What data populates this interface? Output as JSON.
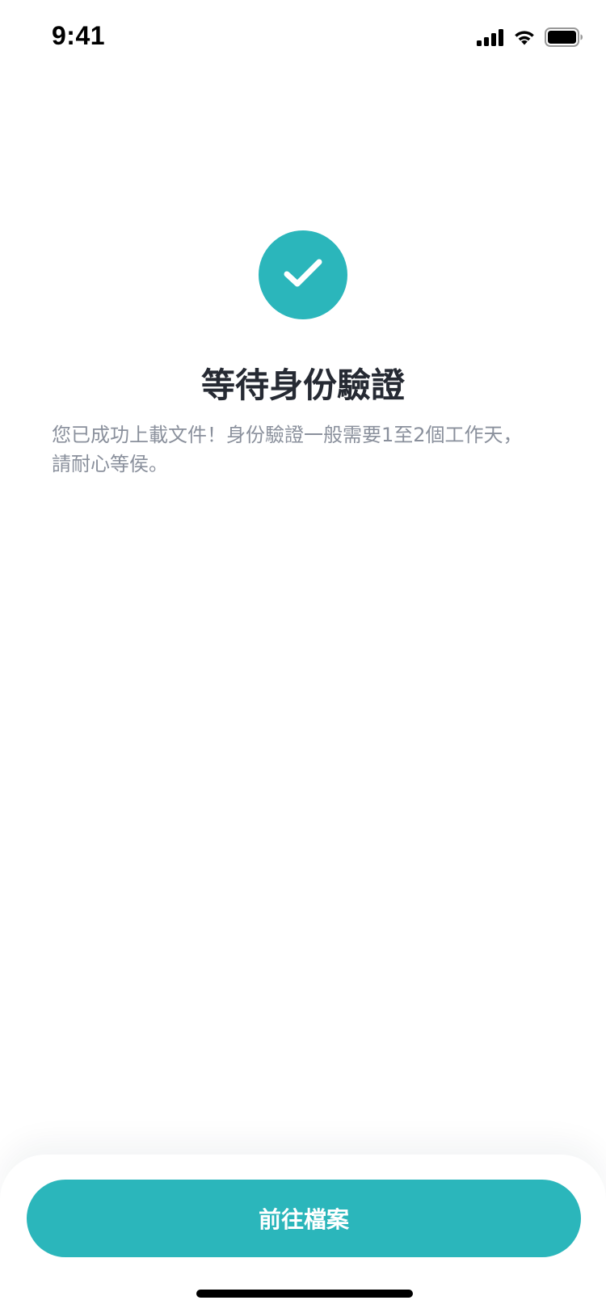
{
  "status_bar": {
    "time": "9:41",
    "icons": [
      "signal-icon",
      "wifi-icon",
      "battery-icon"
    ]
  },
  "main": {
    "success_icon": "checkmark-icon",
    "title": "等待身份驗證",
    "description": "您已成功上載文件！身份驗證一般需要1至2個工作天，請耐心等侯。"
  },
  "footer": {
    "primary_button_label": "前往檔案"
  },
  "colors": {
    "accent": "#2bb6bb",
    "title_text": "#262a33",
    "body_text": "#8a909c"
  }
}
